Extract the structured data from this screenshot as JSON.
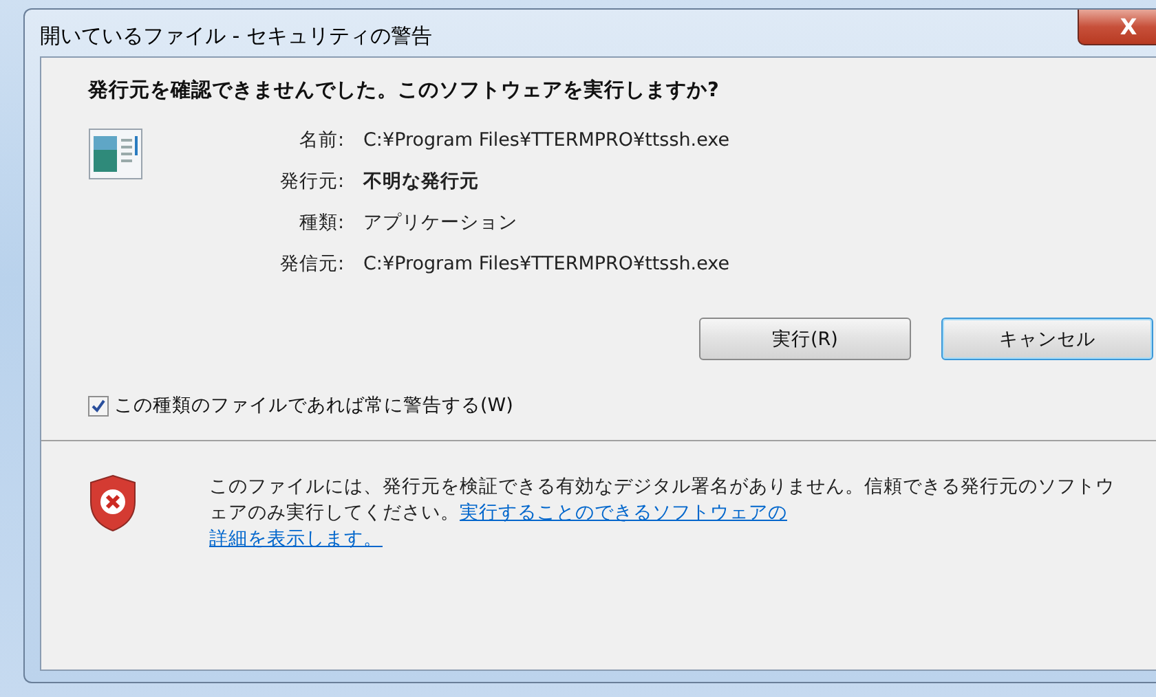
{
  "window": {
    "title": "開いているファイル - セキュリティの警告",
    "close": "X"
  },
  "heading": "発行元を確認できませんでした。このソフトウェアを実行しますか?",
  "details": [
    {
      "label": "名前:",
      "value": "C:¥Program Files¥TTERMPRO¥ttssh.exe",
      "bold": false
    },
    {
      "label": "発行元:",
      "value": "不明な発行元",
      "bold": true
    },
    {
      "label": "種類:",
      "value": "アプリケーション",
      "bold": false
    },
    {
      "label": "発信元:",
      "value": "C:¥Program Files¥TTERMPRO¥ttssh.exe",
      "bold": false
    }
  ],
  "buttons": [
    {
      "label": "実行(R)",
      "default": false
    },
    {
      "label": "キャンセル",
      "default": true
    }
  ],
  "checkbox": {
    "label": "この種類のファイルであれば常に警告する(W)",
    "checked": true
  },
  "footer": {
    "message": "このファイルには、発行元を検証できる有効なデジタル署名がありません。信頼できる発行元のソフトウェアのみ実行してください。",
    "link_lines": [
      "実行することのできるソフトウェアの",
      "詳細を表示します。"
    ]
  }
}
